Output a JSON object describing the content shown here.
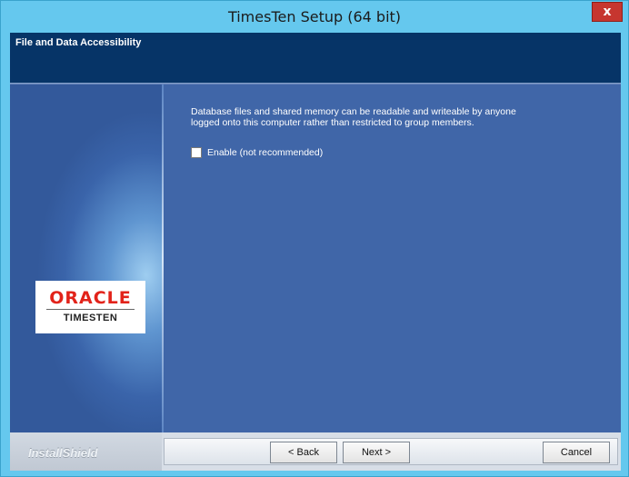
{
  "window": {
    "title": "TimesTen Setup (64 bit)",
    "close_label": "x"
  },
  "header": {
    "title": "File and Data Accessibility"
  },
  "logo": {
    "brand": "ORACLE",
    "product": "TIMESTEN",
    "brand_color": "#e2231a"
  },
  "content": {
    "description_line1": "Database files and shared memory can be readable and writeable by anyone",
    "description_line2": "logged onto this computer rather than restricted to group members.",
    "enable_label": "Enable (not recommended)",
    "enable_checked": false
  },
  "footer": {
    "brand": "InstallShield",
    "back_label": "< Back",
    "next_label": "Next >",
    "cancel_label": "Cancel"
  },
  "colors": {
    "titlebar": "#65c8ee",
    "header_band": "#063467",
    "body": "#4066a8",
    "close_button": "#c6362f"
  }
}
